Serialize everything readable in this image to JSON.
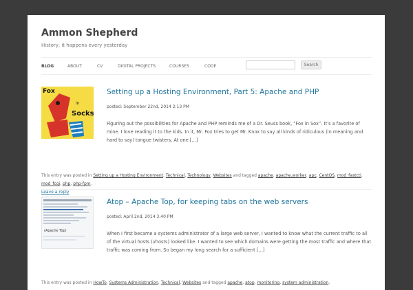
{
  "site": {
    "title": "Ammon Shepherd",
    "tagline": "History, it happens every yesterday"
  },
  "nav": {
    "items": [
      "BLOG",
      "ABOUT",
      "CV",
      "DIGITAL PROJECTS",
      "COURSES",
      "CODE"
    ],
    "active": "BLOG",
    "search_button": "Search",
    "search_placeholder": ""
  },
  "posts": [
    {
      "title": "Setting up a Hosting Environment, Part 5: Apache and PHP",
      "date": "posted: September 22nd, 2014 2:13 PM",
      "excerpt": "Figuring out the possibilities for Apache and PHP reminds me of a Dr. Seuss book, “Fox in Sox”. It’s a favorite of mine. I love reading it to the kids. In it, Mr. Fox tries to get Mr. Knox to say all kinds of ridiculous (in meaning and hard to say) tongue twisters. At one […]",
      "thumbnail": {
        "alt_text": [
          "Fox",
          "in",
          "Socks"
        ]
      },
      "meta_prefix": "This entry was posted in",
      "categories": [
        "Setting up a Hosting Environment",
        "Technical",
        "Technology",
        "Websites"
      ],
      "tagged_word": "and tagged",
      "tags": [
        "apache",
        "apache.worker",
        "apc",
        "CentOS",
        "mod_fastcti",
        "mod_fcgi",
        "php",
        "php-fpm"
      ],
      "reply": "Leave a reply"
    },
    {
      "title": "Atop – Apache Top, for keeping tabs on the web servers",
      "date": "posted: April 2nd, 2014 3:40 PM",
      "excerpt": "When I first became a systems administrator of a large web server, I wanted to know what the current traffic to all of the virtual hosts (vhosts) looked like. I wanted to see which domains were getting the most traffic and where that traffic was coming from. So began my long search for a sufficient […]",
      "thumbnail": {
        "caption": "(Apache Top)"
      },
      "meta_prefix": "This entry was posted in",
      "categories": [
        "HowTo",
        "Systems Administration",
        "Technical",
        "Websites"
      ],
      "tagged_word": "and tagged",
      "tags": [
        "apache",
        "atop",
        "monitoring",
        "system administration"
      ]
    }
  ]
}
